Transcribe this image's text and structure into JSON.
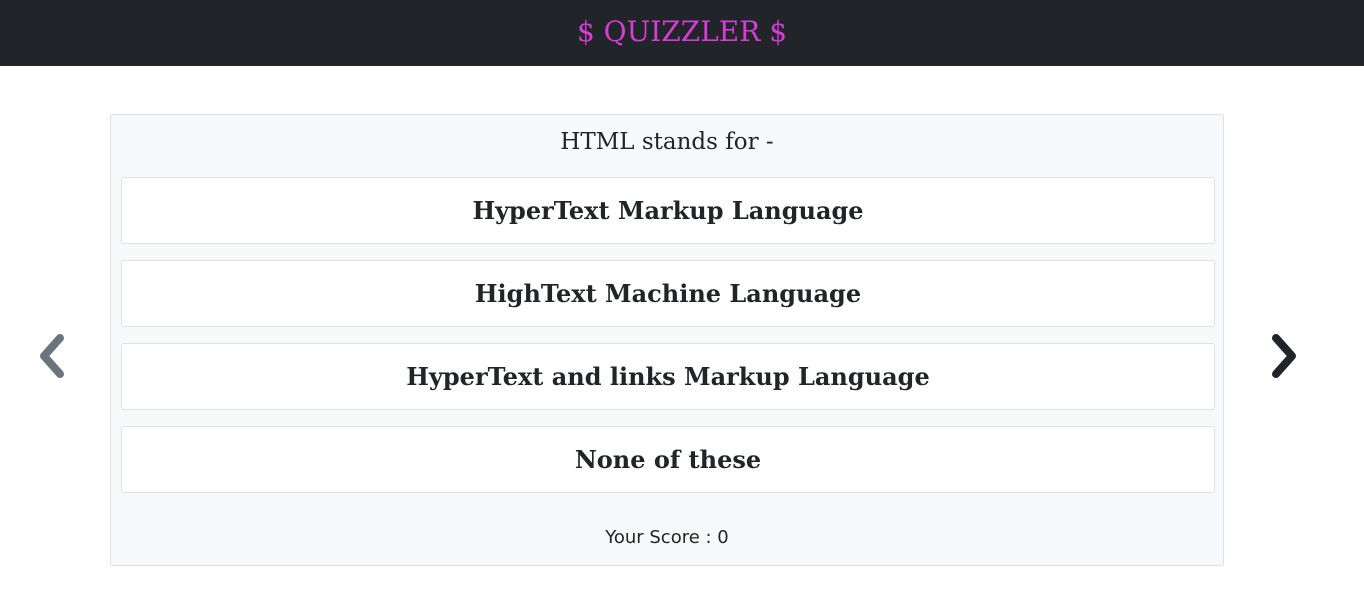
{
  "header": {
    "brand": "$ QUIZZLER $",
    "brand_color": "#d63cd6",
    "background": "#212429"
  },
  "quiz": {
    "question": "HTML stands for -",
    "options": [
      "HyperText Markup Language",
      "HighText Machine Language",
      "HyperText and links Markup Language",
      "None of these"
    ],
    "score_text": "Your Score : 0"
  },
  "navigation": {
    "prev_icon": "chevron-left-icon",
    "next_icon": "chevron-right-icon",
    "prev_color": "#6c757d",
    "next_color": "#212529"
  }
}
